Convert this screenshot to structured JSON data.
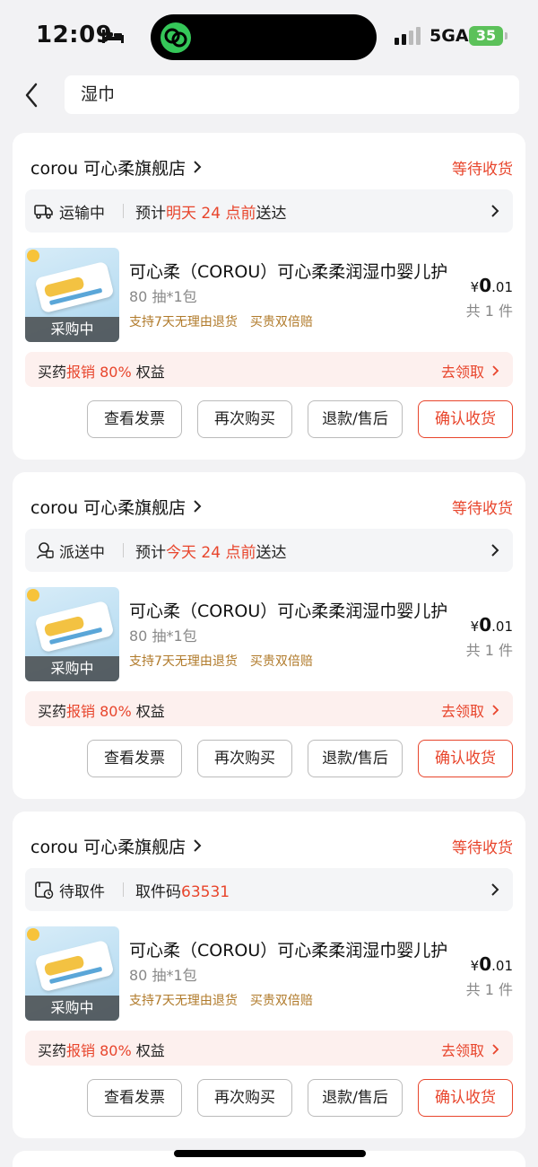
{
  "status_bar": {
    "time": "12:09",
    "network": "5GA",
    "battery": "35"
  },
  "search": {
    "query": "湿巾"
  },
  "colors": {
    "accent": "#e8452c",
    "tag": "#b07a2a",
    "background": "#f2f2f4"
  },
  "orders": [
    {
      "shop": "corou 可心柔旗舰店",
      "status": "等待收货",
      "ship_icon": "truck-icon",
      "ship_state": "运输中",
      "ship_prefix": "预计",
      "ship_highlight": "明天 24 点前",
      "ship_suffix": "送达",
      "image_caption": "采购中",
      "product": "可心柔（COROU）可心柔柔润湿巾婴儿护",
      "spec": "80 抽*1包",
      "tag1": "支持7天无理由退货",
      "tag2": "买贵双倍赔",
      "price_symbol": "¥",
      "price_int": "0",
      "price_dec": ".01",
      "qty": "共 1 件",
      "promo_prefix": "买药",
      "promo_highlight": "报销 80%",
      "promo_suffix": "权益",
      "promo_link": "去领取",
      "buttons": [
        "查看发票",
        "再次购买",
        "退款/售后",
        "确认收货"
      ]
    },
    {
      "shop": "corou 可心柔旗舰店",
      "status": "等待收货",
      "ship_icon": "courier-icon",
      "ship_state": "派送中",
      "ship_prefix": "预计",
      "ship_highlight": "今天 24 点前",
      "ship_suffix": "送达",
      "image_caption": "采购中",
      "product": "可心柔（COROU）可心柔柔润湿巾婴儿护",
      "spec": "80 抽*1包",
      "tag1": "支持7天无理由退货",
      "tag2": "买贵双倍赔",
      "price_symbol": "¥",
      "price_int": "0",
      "price_dec": ".01",
      "qty": "共 1 件",
      "promo_prefix": "买药",
      "promo_highlight": "报销 80%",
      "promo_suffix": "权益",
      "promo_link": "去领取",
      "buttons": [
        "查看发票",
        "再次购买",
        "退款/售后",
        "确认收货"
      ]
    },
    {
      "shop": "corou 可心柔旗舰店",
      "status": "等待收货",
      "ship_icon": "pickup-locker-icon",
      "ship_state": "待取件",
      "ship_prefix": "取件码",
      "ship_highlight": "63531",
      "ship_suffix": "",
      "image_caption": "采购中",
      "product": "可心柔（COROU）可心柔柔润湿巾婴儿护",
      "spec": "80 抽*1包",
      "tag1": "支持7天无理由退货",
      "tag2": "买贵双倍赔",
      "price_symbol": "¥",
      "price_int": "0",
      "price_dec": ".01",
      "qty": "共 1 件",
      "promo_prefix": "买药",
      "promo_highlight": "报销 80%",
      "promo_suffix": "权益",
      "promo_link": "去领取",
      "buttons": [
        "查看发票",
        "再次购买",
        "退款/售后",
        "确认收货"
      ]
    }
  ]
}
